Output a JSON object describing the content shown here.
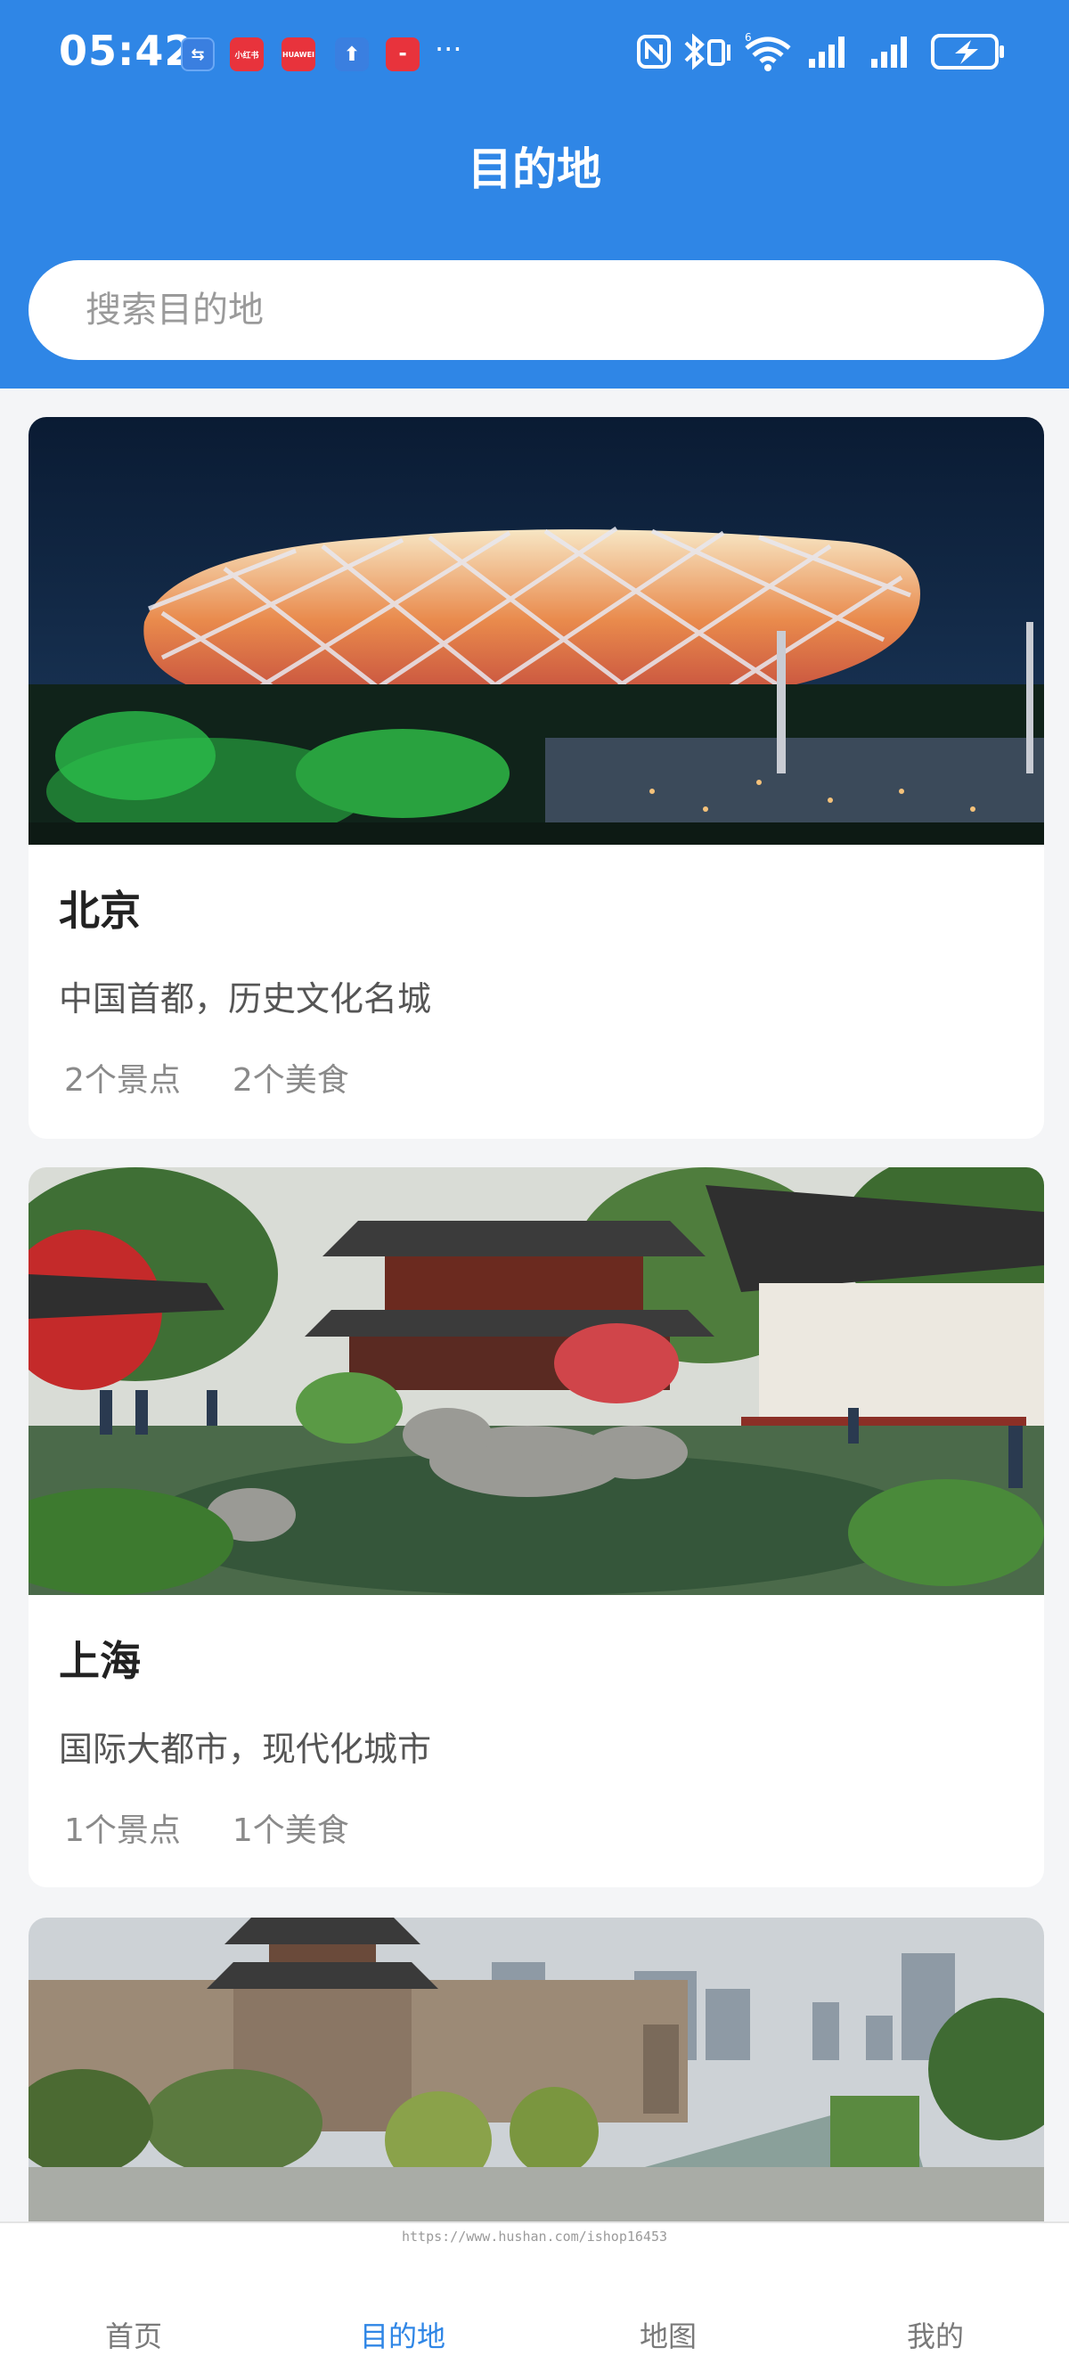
{
  "status_bar": {
    "time": "05:42",
    "notif_icons": [
      "usb-icon",
      "xiaohongshu-app-icon",
      "huawei-app-icon",
      "upload-icon",
      "red-app-icon"
    ],
    "notif_labels": [
      "⇆",
      "小红书",
      "HUAWEI",
      "⬆",
      "▬"
    ],
    "more": "···",
    "network": "6"
  },
  "header": {
    "title": "目的地",
    "color": "#2f86e6"
  },
  "search": {
    "placeholder": "搜索目的地"
  },
  "destinations": [
    {
      "name": "北京",
      "description": "中国首都，历史文化名城",
      "attractions": "2个景点",
      "foods": "2个美食",
      "image_icon": "birds-nest-stadium-photo"
    },
    {
      "name": "上海",
      "description": "国际大都市，现代化城市",
      "attractions": "1个景点",
      "foods": "1个美食",
      "image_icon": "classical-garden-photo"
    },
    {
      "name": "",
      "description": "",
      "attractions": "",
      "foods": "",
      "image_icon": "city-wall-photo"
    }
  ],
  "watermark": "https://www.hushan.com/ishop16453",
  "bottom_nav": {
    "items": [
      {
        "label": "首页"
      },
      {
        "label": "目的地"
      },
      {
        "label": "地图"
      },
      {
        "label": "我的"
      }
    ],
    "active_index": 1,
    "active_color": "#2f86e6"
  }
}
